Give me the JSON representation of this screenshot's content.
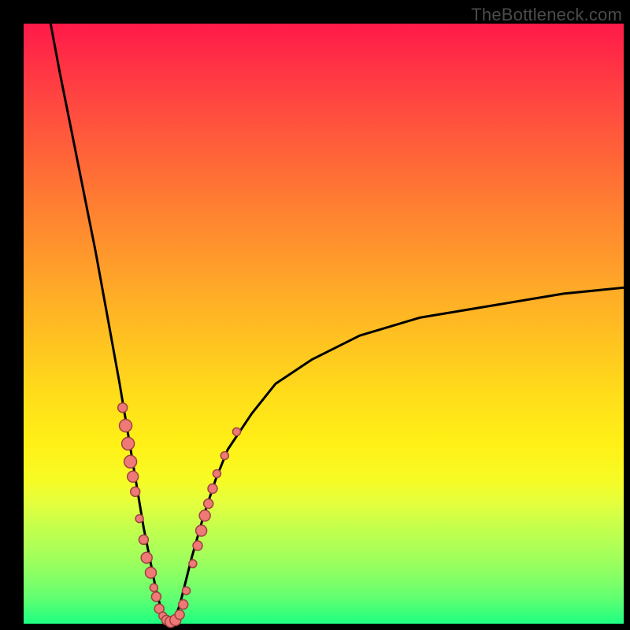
{
  "watermark": "TheBottleneck.com",
  "colors": {
    "black": "#000000",
    "dot_fill": "#ef7976",
    "dot_stroke": "#9c4341",
    "gradient_top": "#ff1a49",
    "gradient_bottom": "#1cff82"
  },
  "chart_data": {
    "type": "line",
    "title": "",
    "xlabel": "",
    "ylabel": "",
    "xlim": [
      0,
      100
    ],
    "ylim": [
      0,
      100
    ],
    "x_min_point": 24,
    "description": "V-shaped curve with minimum near x≈24%; y rises steeply to both sides approaching y≈100 at x≈0 and y≈55 at x=100.",
    "curve_samples": [
      {
        "x": 4.5,
        "y": 100
      },
      {
        "x": 6.0,
        "y": 92
      },
      {
        "x": 8.0,
        "y": 82
      },
      {
        "x": 10.0,
        "y": 72
      },
      {
        "x": 12.0,
        "y": 62
      },
      {
        "x": 14.0,
        "y": 51
      },
      {
        "x": 16.0,
        "y": 40
      },
      {
        "x": 18.0,
        "y": 28
      },
      {
        "x": 19.0,
        "y": 22
      },
      {
        "x": 20.0,
        "y": 16
      },
      {
        "x": 21.0,
        "y": 11
      },
      {
        "x": 22.0,
        "y": 6
      },
      {
        "x": 23.0,
        "y": 2
      },
      {
        "x": 24.0,
        "y": 0
      },
      {
        "x": 25.0,
        "y": 0.5
      },
      {
        "x": 26.0,
        "y": 3
      },
      {
        "x": 27.0,
        "y": 7
      },
      {
        "x": 28.0,
        "y": 11
      },
      {
        "x": 30.0,
        "y": 18
      },
      {
        "x": 32.0,
        "y": 24
      },
      {
        "x": 34.0,
        "y": 29
      },
      {
        "x": 38.0,
        "y": 35
      },
      {
        "x": 42.0,
        "y": 40
      },
      {
        "x": 48.0,
        "y": 44
      },
      {
        "x": 56.0,
        "y": 48
      },
      {
        "x": 66.0,
        "y": 51
      },
      {
        "x": 78.0,
        "y": 53
      },
      {
        "x": 90.0,
        "y": 55
      },
      {
        "x": 100.0,
        "y": 56
      }
    ],
    "series": [
      {
        "name": "left-cluster",
        "points": [
          {
            "x": 16.5,
            "y": 36,
            "r": 6
          },
          {
            "x": 17.0,
            "y": 33,
            "r": 8
          },
          {
            "x": 17.4,
            "y": 30,
            "r": 8
          },
          {
            "x": 17.8,
            "y": 27,
            "r": 8
          },
          {
            "x": 18.2,
            "y": 24.5,
            "r": 7
          },
          {
            "x": 18.6,
            "y": 22,
            "r": 6
          },
          {
            "x": 19.3,
            "y": 17.5,
            "r": 5
          },
          {
            "x": 20.0,
            "y": 14,
            "r": 6
          },
          {
            "x": 20.5,
            "y": 11,
            "r": 7
          },
          {
            "x": 21.2,
            "y": 8.5,
            "r": 7
          },
          {
            "x": 21.7,
            "y": 6,
            "r": 5
          },
          {
            "x": 22.1,
            "y": 4.5,
            "r": 6
          },
          {
            "x": 22.6,
            "y": 2.5,
            "r": 6
          },
          {
            "x": 23.2,
            "y": 1.3,
            "r": 5
          },
          {
            "x": 23.8,
            "y": 0.6,
            "r": 6
          },
          {
            "x": 24.5,
            "y": 0.3,
            "r": 7
          },
          {
            "x": 25.3,
            "y": 0.6,
            "r": 7
          },
          {
            "x": 26.0,
            "y": 1.5,
            "r": 6
          },
          {
            "x": 26.6,
            "y": 3.2,
            "r": 6
          },
          {
            "x": 27.1,
            "y": 5.5,
            "r": 5
          }
        ]
      },
      {
        "name": "right-cluster",
        "points": [
          {
            "x": 28.2,
            "y": 10,
            "r": 5
          },
          {
            "x": 29.0,
            "y": 13,
            "r": 6
          },
          {
            "x": 29.6,
            "y": 15.5,
            "r": 7
          },
          {
            "x": 30.2,
            "y": 18,
            "r": 7
          },
          {
            "x": 30.8,
            "y": 20,
            "r": 6
          },
          {
            "x": 31.5,
            "y": 22.5,
            "r": 6
          },
          {
            "x": 32.2,
            "y": 25,
            "r": 5
          },
          {
            "x": 33.5,
            "y": 28,
            "r": 5
          },
          {
            "x": 35.5,
            "y": 32,
            "r": 5
          }
        ]
      }
    ]
  }
}
